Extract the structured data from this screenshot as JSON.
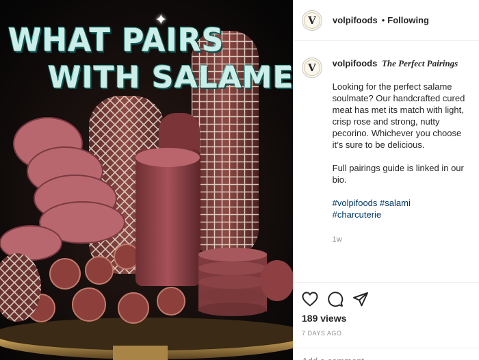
{
  "post": {
    "username": "volpifoods",
    "follow_status": "Following",
    "avatar_letter": "V",
    "caption": {
      "title": "The Perfect Pairings",
      "paragraph1": "Looking for the perfect salame soulmate? Our handcrafted cured meat has met its match with light, crisp rose and strong, nutty pecorino. Whichever you choose it’s sure to be delicious.",
      "paragraph2": "Full pairings guide is linked in our bio.",
      "hashtags": [
        "#volpifoods",
        "#salami",
        "#charcuterie"
      ],
      "age": "1w"
    },
    "views": "189 views",
    "date": "7 DAYS AGO",
    "comment_placeholder": "Add a comment..."
  },
  "media": {
    "headline_line1": "WHAT PAIRS",
    "headline_line2": "WITH SALAME?"
  },
  "icons": [
    "heart-icon",
    "comment-icon",
    "share-icon"
  ],
  "colors": {
    "hashtag": "#00376b",
    "muted": "#8e8e8e",
    "headline": "#cdeee8",
    "divider": "#efefef"
  }
}
